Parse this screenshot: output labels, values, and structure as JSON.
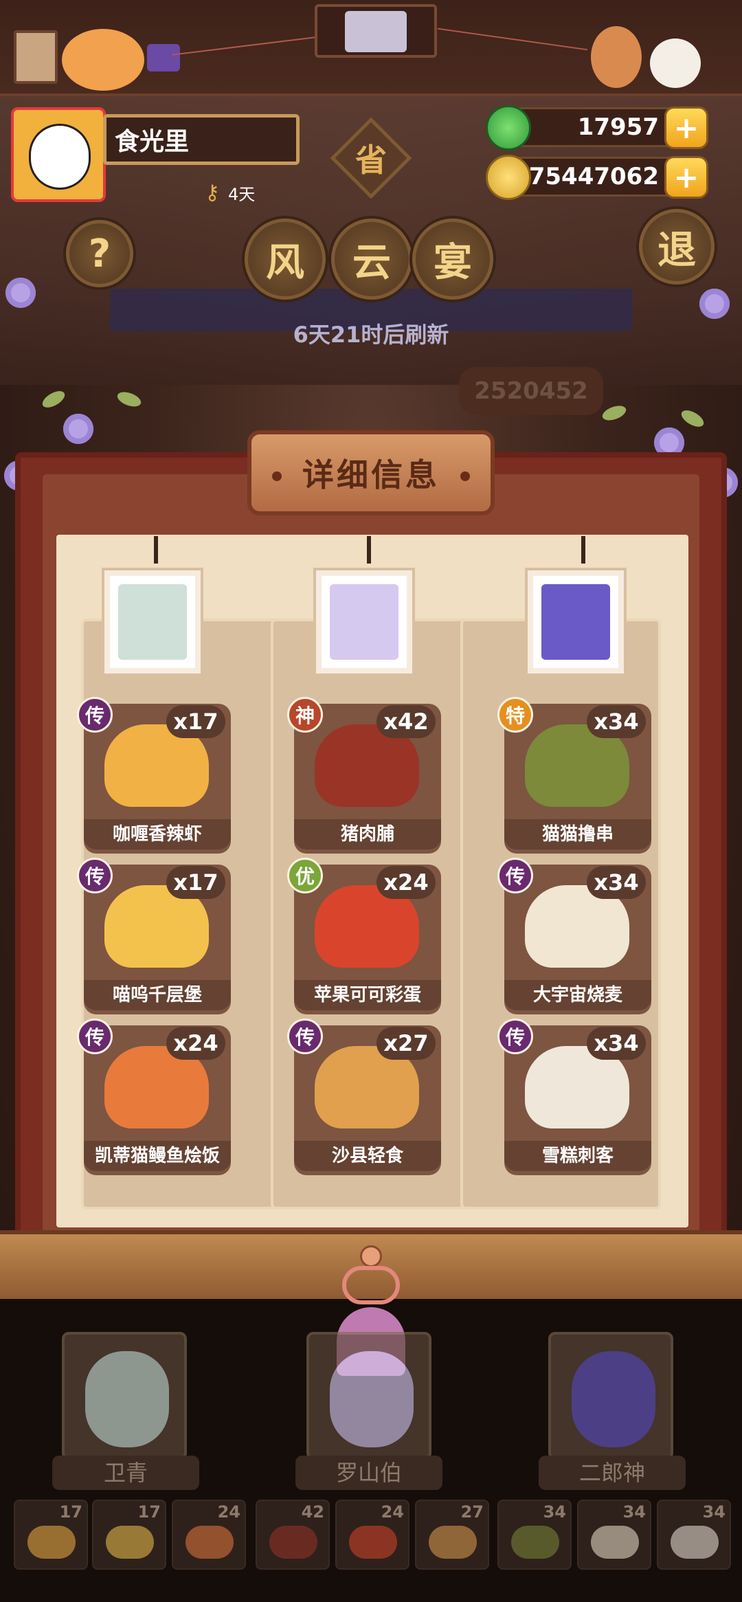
{
  "player": {
    "name": "食光里",
    "days_label": "4天"
  },
  "currency": {
    "jade": "17957",
    "coins": "75447062"
  },
  "top_buttons": {
    "help": "?",
    "province": "省",
    "exit": "退",
    "event": [
      "风",
      "云",
      "宴"
    ]
  },
  "refresh_text": "6天21时后刷新",
  "score_partial": "2520452",
  "panel": {
    "title": "详细信息",
    "columns": [
      {
        "chef": "卫青",
        "dishes": [
          {
            "name": "咖喱香辣虾",
            "rank": "传",
            "qty": "x17"
          },
          {
            "name": "喵呜千层堡",
            "rank": "传",
            "qty": "x17"
          },
          {
            "name": "凯蒂猫鳗鱼烩饭",
            "rank": "传",
            "qty": "x24"
          }
        ]
      },
      {
        "chef": "罗山伯",
        "dishes": [
          {
            "name": "猪肉脯",
            "rank": "神",
            "qty": "x42"
          },
          {
            "name": "苹果可可彩蛋",
            "rank": "优",
            "qty": "x24"
          },
          {
            "name": "沙县轻食",
            "rank": "传",
            "qty": "x27"
          }
        ]
      },
      {
        "chef": "二郎神",
        "dishes": [
          {
            "name": "猫猫撸串",
            "rank": "特",
            "qty": "x34"
          },
          {
            "name": "大宇宙烧麦",
            "rank": "传",
            "qty": "x34"
          },
          {
            "name": "雪糕刺客",
            "rank": "传",
            "qty": "x34"
          }
        ]
      }
    ]
  },
  "chef_labels": [
    "卫青",
    "罗山伯",
    "二郎神"
  ],
  "tray": [
    "17",
    "17",
    "24",
    "42",
    "24",
    "27",
    "34",
    "34",
    "34"
  ],
  "colors": {
    "rank_chuan": "#6a2a6e",
    "rank_shen": "#b8462a",
    "rank_you": "#7aa63a",
    "rank_te": "#e58f1f",
    "plus_button": "#f5b62a"
  }
}
